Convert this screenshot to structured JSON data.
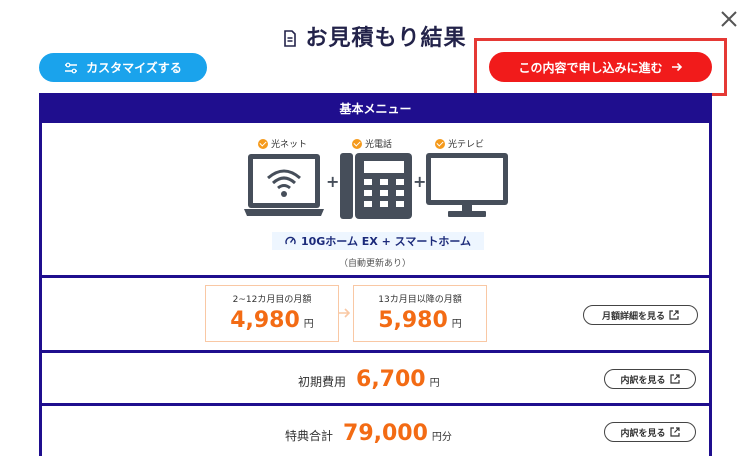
{
  "header": {
    "title": "お見積もり結果",
    "customize_label": "カスタマイズする",
    "apply_label": "この内容で申し込みに進む"
  },
  "panel": {
    "header": "基本メニュー",
    "devices": [
      {
        "label": "光ネット",
        "icon": "laptop-wifi-icon"
      },
      {
        "label": "光電話",
        "icon": "phone-icon"
      },
      {
        "label": "光テレビ",
        "icon": "monitor-icon"
      }
    ],
    "plan_name": "10Gホーム EX + スマートホーム",
    "auto_renew": "（自動更新あり）"
  },
  "monthly": {
    "first": {
      "label": "2~12カ月目の月額",
      "amount": "4,980",
      "unit": "円"
    },
    "later": {
      "label": "13カ月目以降の月額",
      "amount": "5,980",
      "unit": "円"
    },
    "detail_button": "月額詳細を見る"
  },
  "initial_cost": {
    "label": "初期費用",
    "amount": "6,700",
    "unit": "円",
    "button": "内訳を見る"
  },
  "benefit_total": {
    "label": "特典合計",
    "amount": "79,000",
    "unit": "円分",
    "button": "内訳を見る"
  },
  "colors": {
    "navy": "#1f0e8e",
    "blue_button": "#1aa3ec",
    "red_button": "#f11b1b",
    "orange": "#f36b14",
    "highlight": "#e53935"
  }
}
